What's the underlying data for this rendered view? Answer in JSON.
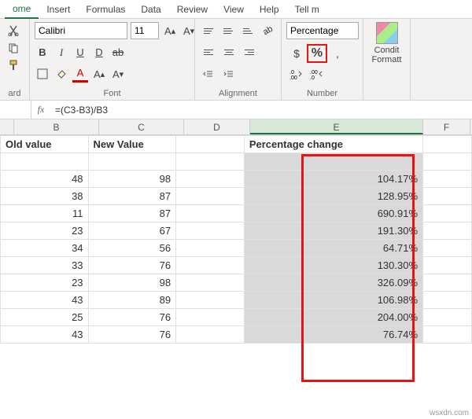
{
  "tabs": [
    "ome",
    "Insert",
    "Formulas",
    "Data",
    "Review",
    "View",
    "Help",
    "Tell m"
  ],
  "active_tab": 0,
  "font": {
    "name": "Calibri",
    "size": "11"
  },
  "number_format": "Percentage",
  "formula": "=(C3-B3)/B3",
  "cols": {
    "B": "B",
    "C": "C",
    "D": "D",
    "E": "E",
    "F": "F"
  },
  "headers": {
    "B": "Old value",
    "C": "New Value",
    "E": "Percentage change"
  },
  "group_labels": {
    "clipboard": "ard",
    "font": "Font",
    "alignment": "Alignment",
    "number": "Number"
  },
  "condf": {
    "line1": "Condit",
    "line2": "Formatt"
  },
  "symbols": {
    "dollar": "$",
    "percent": "%",
    "comma": ",",
    "inc": ".0→.00",
    "dec": ".00→.0",
    "ab": "ab"
  },
  "chart_data": {
    "type": "table",
    "columns": [
      "Old value",
      "New Value",
      "Percentage change"
    ],
    "rows": [
      {
        "old": 48,
        "new": 98,
        "pct": "104.17%"
      },
      {
        "old": 38,
        "new": 87,
        "pct": "128.95%"
      },
      {
        "old": 11,
        "new": 87,
        "pct": "690.91%"
      },
      {
        "old": 23,
        "new": 67,
        "pct": "191.30%"
      },
      {
        "old": 34,
        "new": 56,
        "pct": "64.71%"
      },
      {
        "old": 33,
        "new": 76,
        "pct": "130.30%"
      },
      {
        "old": 23,
        "new": 98,
        "pct": "326.09%"
      },
      {
        "old": 43,
        "new": 89,
        "pct": "106.98%"
      },
      {
        "old": 25,
        "new": 76,
        "pct": "204.00%"
      },
      {
        "old": 43,
        "new": 76,
        "pct": "76.74%"
      }
    ]
  },
  "watermark": "wsxdn.com"
}
